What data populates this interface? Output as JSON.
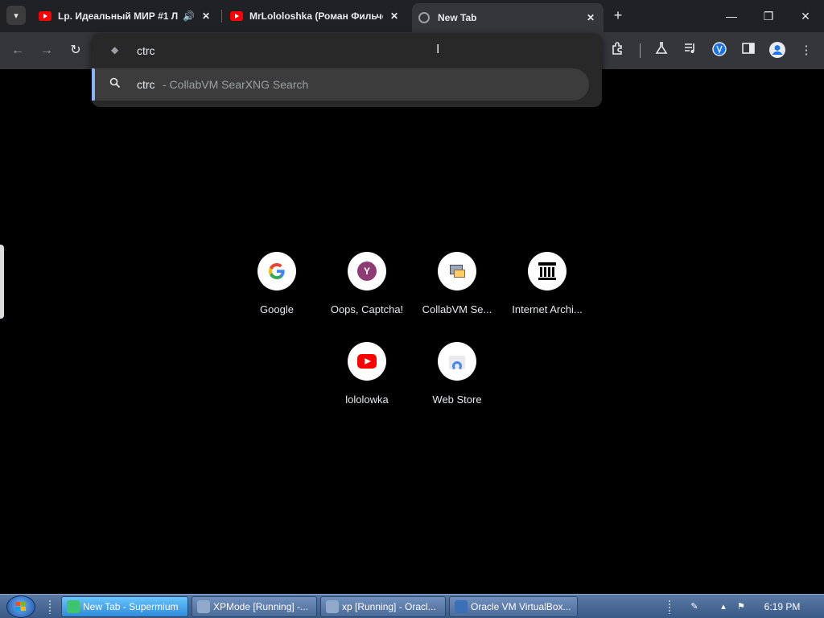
{
  "browser": {
    "tabs": [
      {
        "title": "Lp. Идеальный МИР #1 Л",
        "favicon": "youtube-icon",
        "audio": true,
        "active": false
      },
      {
        "title": "MrLololoshka (Роман Фильчен",
        "favicon": "youtube-icon",
        "audio": false,
        "active": false
      },
      {
        "title": "New Tab",
        "favicon": "globe-icon",
        "audio": false,
        "active": true
      }
    ],
    "new_tab_symbol": "+",
    "window_controls": {
      "minimize": "—",
      "restore": "❐",
      "close": "✕"
    }
  },
  "toolbar": {
    "back": "←",
    "forward": "→",
    "reload": "↻",
    "icons": [
      "extensions-icon",
      "labs-icon",
      "media-controls-icon",
      "vpn-icon",
      "side-panel-icon",
      "profile-icon",
      "menu-icon"
    ]
  },
  "omnibox": {
    "input_value": "ctrc",
    "suggestion_query": "ctrc",
    "suggestion_rest": " - CollabVM SearXNG Search"
  },
  "shortcuts": [
    {
      "label": "Google",
      "icon": "google-icon"
    },
    {
      "label": "Oops, Captcha!",
      "icon": "y-icon"
    },
    {
      "label": "CollabVM Se...",
      "icon": "collabvm-icon"
    },
    {
      "label": "Internet Archi...",
      "icon": "internet-archive-icon"
    },
    {
      "label": "lololowka",
      "icon": "youtube-icon"
    },
    {
      "label": "Web Store",
      "icon": "web-store-icon"
    }
  ],
  "taskbar": {
    "buttons": [
      {
        "label": "New Tab - Supermium",
        "active": true
      },
      {
        "label": "XPMode [Running] -...",
        "active": false
      },
      {
        "label": "xp [Running] - Oracl...",
        "active": false
      },
      {
        "label": "Oracle VM VirtualBox...",
        "active": false
      }
    ],
    "clock": "6:19 PM"
  },
  "colors": {
    "accent": "#8ab4f8",
    "tab_strip": "#202124",
    "toolbar": "#35363a",
    "taskbar": "#3a5a86"
  }
}
